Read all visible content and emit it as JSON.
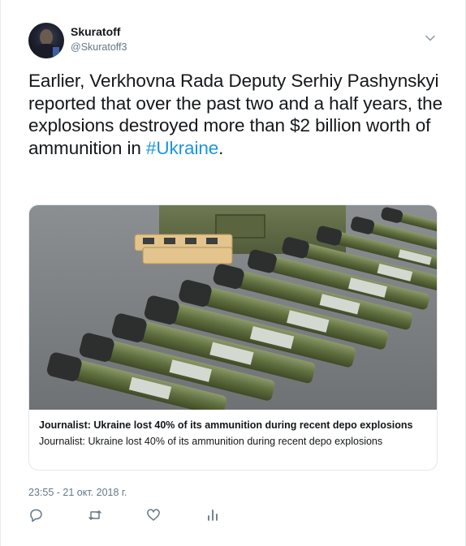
{
  "author": {
    "name": "Skuratoff",
    "handle": "@Skuratoff3"
  },
  "tweet": {
    "text_main": "Earlier, Verkhovna Rada Deputy Serhiy Pashynskyi reported that over the past two and a half years, the explosions destroyed more than $2 billion worth of ammunition in ",
    "hashtag": "#Ukraine",
    "text_end": ".",
    "timestamp": "23:55 - 21 окт. 2018 г."
  },
  "card": {
    "title": "Journalist: Ukraine lost 40% of its ammunition during recent depo explosions",
    "description": "Journalist: Ukraine lost 40% of its ammunition during recent depo explosions",
    "image_subject": "rows of green RPG launcher tubes laid on pavement"
  },
  "icons": {
    "caret": "chevron-down-icon",
    "reply": "reply-icon",
    "retweet": "retweet-icon",
    "like": "heart-icon",
    "analytics": "analytics-icon"
  },
  "colors": {
    "text": "#14171a",
    "secondary": "#657786",
    "link": "#1b95e0",
    "border": "#e1e8ed"
  }
}
